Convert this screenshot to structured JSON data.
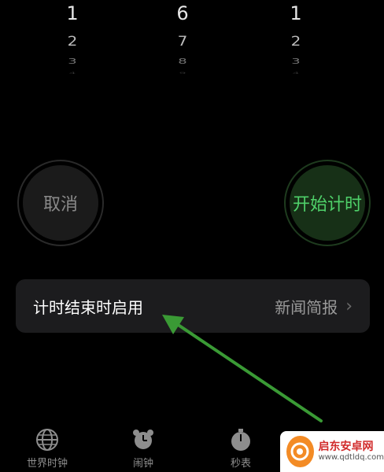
{
  "picker": {
    "hours": [
      "1",
      "2",
      "3",
      "4"
    ],
    "minutes": [
      "6",
      "7",
      "8",
      "9"
    ],
    "seconds": [
      "1",
      "2",
      "3",
      "4"
    ]
  },
  "buttons": {
    "cancel": "取消",
    "start": "开始计时"
  },
  "timer_end": {
    "label": "计时结束时启用",
    "value": "新闻简报",
    "chevron": "›"
  },
  "annotation": {
    "color": "#3a9a35"
  },
  "tabs": [
    {
      "label": "世界时钟",
      "icon": "globe-icon"
    },
    {
      "label": "闹钟",
      "icon": "alarm-clock-icon"
    },
    {
      "label": "秒表",
      "icon": "stopwatch-icon"
    },
    {
      "label": "",
      "icon": "timer-icon"
    }
  ],
  "watermark": {
    "title": "启东安卓网",
    "url": "www.qdtldq.com"
  },
  "colors": {
    "accent_green": "#4fd16a",
    "tab_active": "#ff9f0a",
    "row_bg": "#1c1c1e"
  }
}
